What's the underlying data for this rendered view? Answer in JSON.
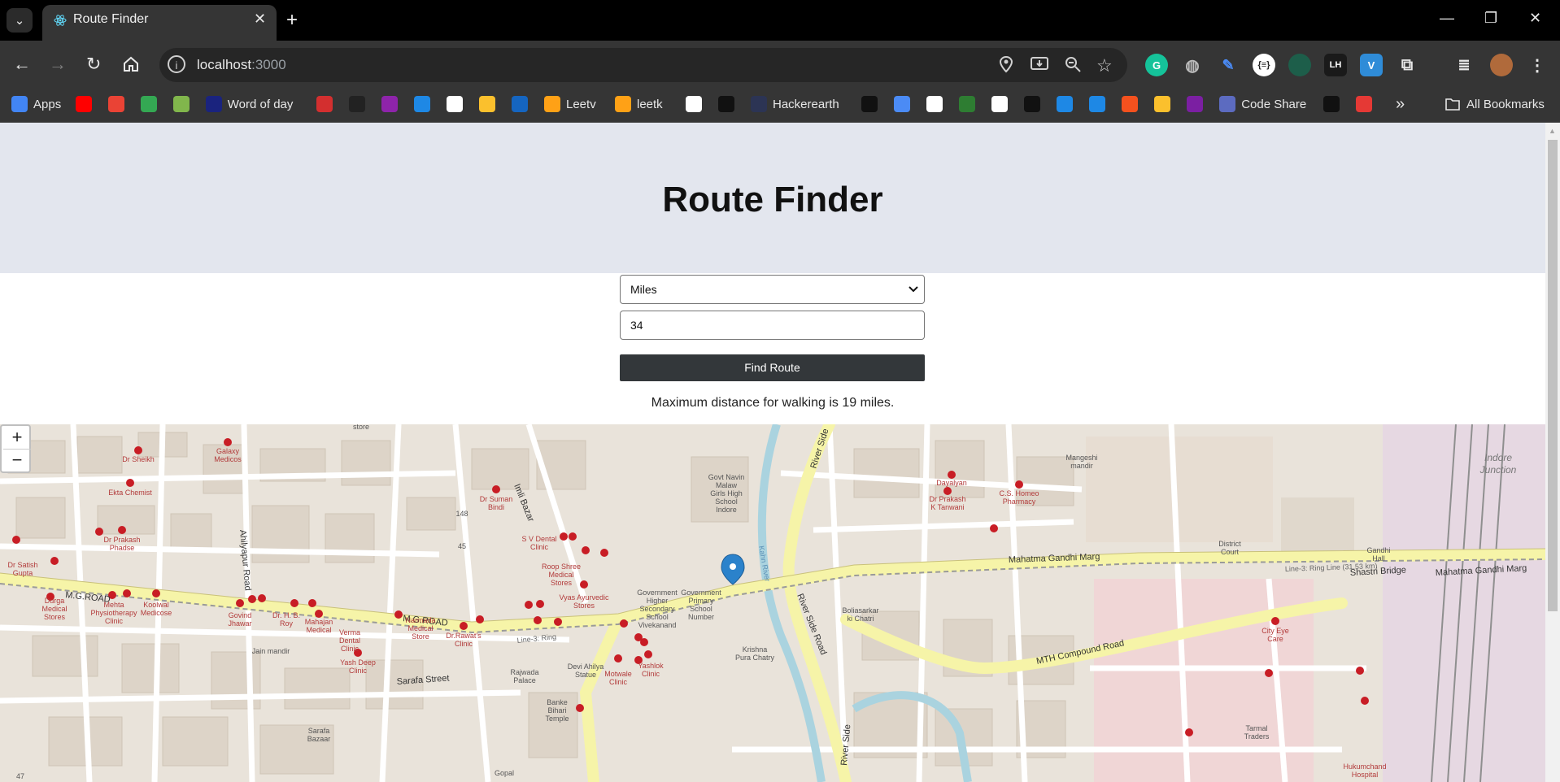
{
  "browser": {
    "tab_title": "Route Finder",
    "tab_close": "✕",
    "new_tab": "+",
    "url_host": "localhost",
    "url_port": ":3000",
    "window_controls": [
      "—",
      "❐",
      "✕"
    ],
    "bookmarks": [
      {
        "label": "Apps",
        "icon": "apps-grid-icon",
        "color": "#4285f4"
      },
      {
        "label": "",
        "icon": "youtube-icon",
        "color": "#ff0000"
      },
      {
        "label": "",
        "icon": "gmail-icon",
        "color": "#ea4335"
      },
      {
        "label": "",
        "icon": "maps-icon",
        "color": "#34a853"
      },
      {
        "label": "",
        "icon": "chess-icon",
        "color": "#81b64c"
      },
      {
        "label": "Word of day",
        "icon": "dictionary-icon",
        "color": "#1a237e"
      },
      {
        "label": "",
        "icon": "ui-icon",
        "color": "#d32f2f"
      },
      {
        "label": "",
        "icon": "dark-logo-icon",
        "color": "#222222"
      },
      {
        "label": "",
        "icon": "purple-logo-icon",
        "color": "#8e24aa"
      },
      {
        "label": "",
        "icon": "play-icon",
        "color": "#1e88e5"
      },
      {
        "label": "",
        "icon": "amazon-icon",
        "color": "#ffffff"
      },
      {
        "label": "",
        "icon": "yellow-logo-icon",
        "color": "#fbc02d"
      },
      {
        "label": "",
        "icon": "rupee-icon",
        "color": "#1565c0"
      },
      {
        "label": "Leetv",
        "icon": "leetcode-icon",
        "color": "#ffa116"
      },
      {
        "label": "leetk",
        "icon": "leetcode-icon",
        "color": "#ffa116"
      },
      {
        "label": "",
        "icon": "openai-icon",
        "color": "#ffffff"
      },
      {
        "label": "",
        "icon": "hackerrank-icon",
        "color": "#111111"
      },
      {
        "label": "Hackerearth",
        "icon": "hackerearth-icon",
        "color": "#2c3454"
      },
      {
        "label": "",
        "icon": "p-icon",
        "color": "#111111"
      },
      {
        "label": "",
        "icon": "gemini-icon",
        "color": "#4b8bf5"
      },
      {
        "label": "",
        "icon": "github-icon",
        "color": "#ffffff"
      },
      {
        "label": "",
        "icon": "green-infinity-icon",
        "color": "#2e7d32"
      },
      {
        "label": "",
        "icon": "smiley-icon",
        "color": "#ffffff"
      },
      {
        "label": "",
        "icon": "c-icon",
        "color": "#111111"
      },
      {
        "label": "",
        "icon": "flag-icon",
        "color": "#1e88e5"
      },
      {
        "label": "",
        "icon": "code-icon",
        "color": "#1e88e5"
      },
      {
        "label": "",
        "icon": "orange-card-icon",
        "color": "#f4511e"
      },
      {
        "label": "",
        "icon": "pen-icon",
        "color": "#fbc02d"
      },
      {
        "label": "",
        "icon": "b-icon",
        "color": "#7b1fa2"
      },
      {
        "label": "Code Share",
        "icon": "dot-icon",
        "color": "#5c6bc0"
      },
      {
        "label": "",
        "icon": "pen-box-icon",
        "color": "#111111"
      },
      {
        "label": "",
        "icon": "mascot-icon",
        "color": "#e53935"
      }
    ],
    "overflow": "»",
    "all_bookmarks": "All Bookmarks"
  },
  "page": {
    "title": "Route Finder",
    "unit_select": "Miles",
    "distance_value": "34",
    "find_button": "Find Route",
    "status": "Maximum distance for walking is 19 miles."
  },
  "map": {
    "zoom_in": "+",
    "zoom_out": "−",
    "road_labels": [
      "M.G.ROAD",
      "M.G.ROAD",
      "Mahatma Gandhi Marg",
      "Mahatma Gandhi Marg",
      "Shastri Bridge",
      "MTH Compound Road",
      "River Side Road",
      "River Side",
      "River Side",
      "Sarafa Street",
      "Ahilyapur Road",
      "Imli Bazar",
      "Line-3: Ring Line (31.53 km)",
      "Line-3: Ring",
      "Kahn River"
    ],
    "place_labels": [
      "Dr Sheikh",
      "Galaxy Medicos",
      "Ekta Chemist",
      "Dr Prakash Phadse",
      "Dr Satish Gupta",
      "Durga Medical Stores",
      "Mehta Physiotherapy Clinic",
      "Koolwal Medicose",
      "Govind Jhawar",
      "Dr. H. B. Roy",
      "Mahajan Medical",
      "Verma Dental Clinic",
      "Narmada Medical Store",
      "Dr.Rawat's Clinic",
      "Jain mandir",
      "Yash Deep Clinic",
      "Sarafa Bazaar",
      "Dr Suman Bindi",
      "S V Dental Clinic",
      "Roop Shree Medical Stores",
      "Vyas Ayurvedic Stores",
      "Government Higher Secondary School Vivekanand",
      "Govt Navin Malaw Girls High School Indore",
      "Government Primary School Number",
      "Rajwada Palace",
      "Devi Ahilya Statue",
      "Motwale Clinic",
      "Yashlok Clinic",
      "Banke Bihari Temple",
      "Gopal",
      "Krishna Pura Chatry",
      "Boliasarkar ki Chatri",
      "Dayalyan",
      "Dr Prakash K Tanwani",
      "C.S. Homeo Pharmacy",
      "Mangeshi mandir",
      "District Court",
      "Gandhi Hall",
      "Indore Junction",
      "City Eye Care",
      "Tarmal Traders",
      "Hukumchand Hospital",
      "45",
      "148",
      "47",
      "store"
    ]
  }
}
